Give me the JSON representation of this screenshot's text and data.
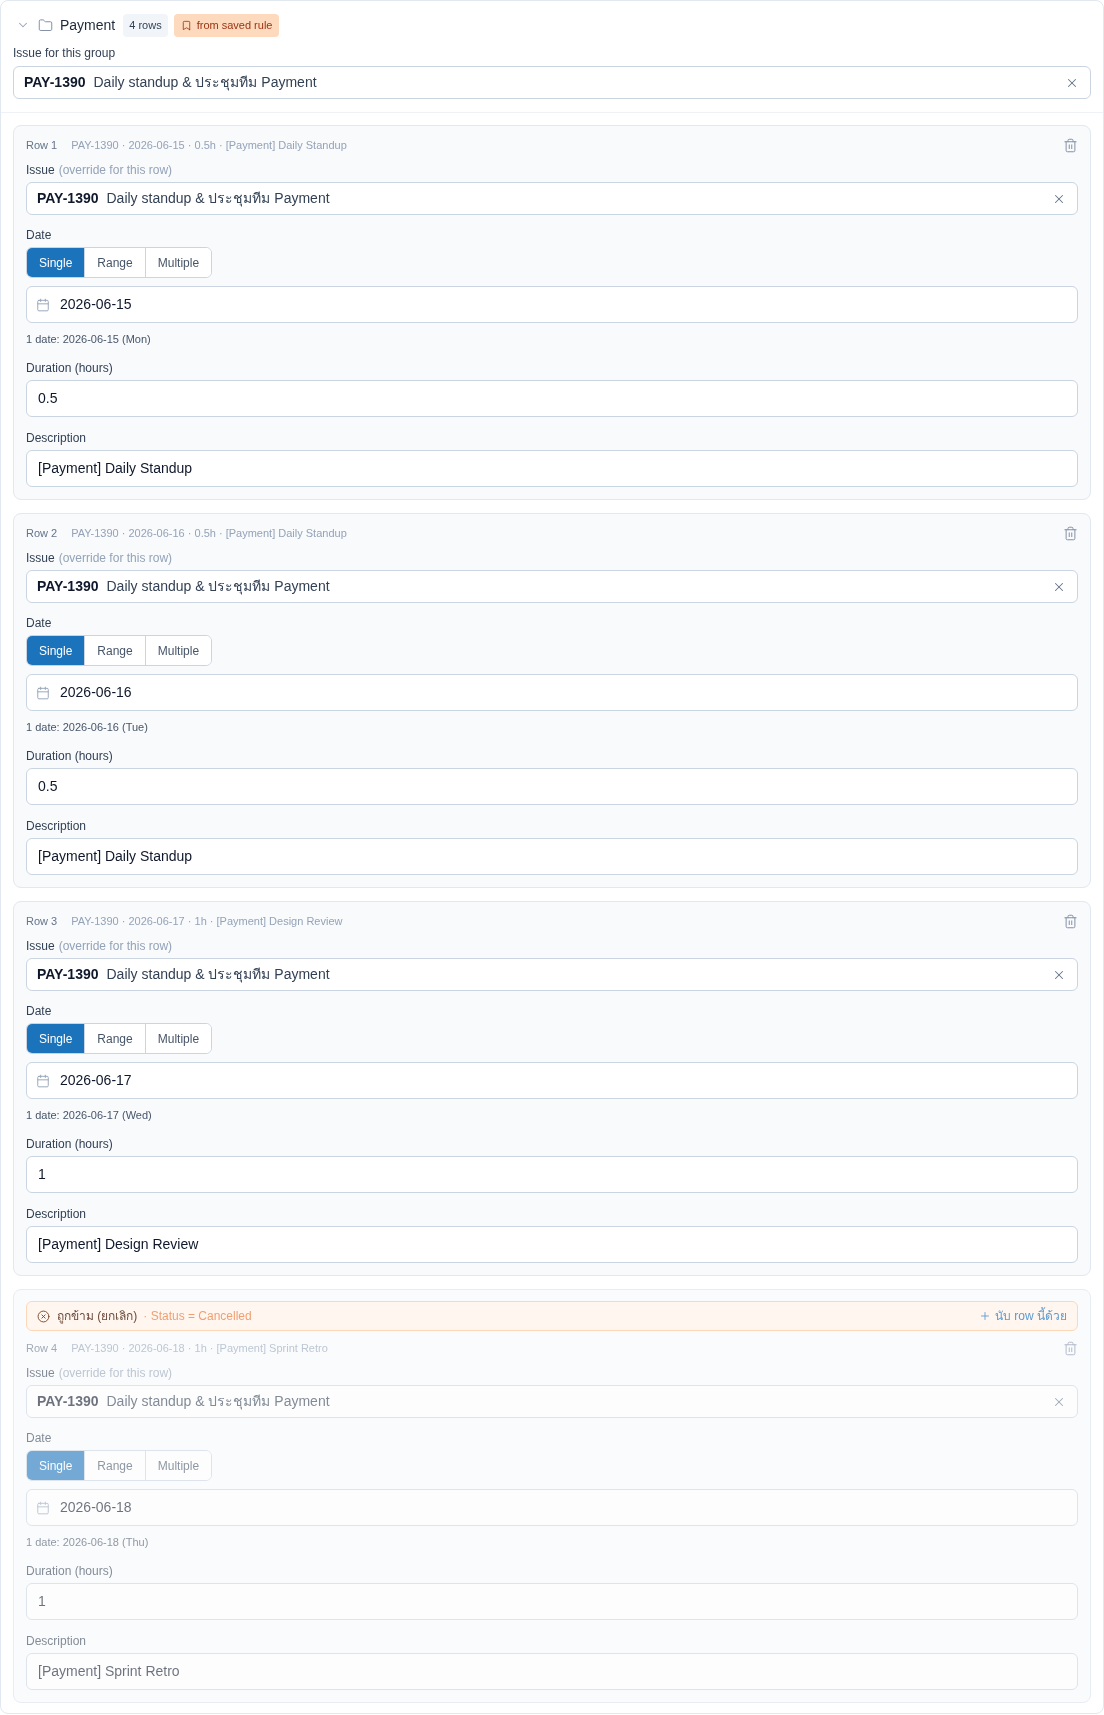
{
  "group": {
    "expanded": true,
    "name": "Payment",
    "row_count": "4 rows",
    "rule_tag": "from saved rule"
  },
  "group_issue": {
    "label": "Issue for this group",
    "key": "PAY-1390",
    "summary": "Daily standup & ประชุมทีม Payment"
  },
  "rows": [
    {
      "title": "Row 1",
      "summary": "PAY-1390 · 2026-06-15 · 0.5h · [Payment] Daily Standup",
      "skipped": false,
      "issue_label": "Issue",
      "issue_hint": "(override for this row)",
      "issue": {
        "key": "PAY-1390",
        "summary": "Daily standup & ประชุมทีม Payment"
      },
      "date_label": "Date",
      "date_modes": [
        {
          "label": "Single",
          "selected": true
        },
        {
          "label": "Range",
          "selected": false
        },
        {
          "label": "Multiple",
          "selected": false
        }
      ],
      "date": "2026-06-15",
      "date_note": "1 date: 2026-06-15 (Mon)",
      "duration_label": "Duration (hours)",
      "duration": "0.5",
      "description_label": "Description",
      "description": "[Payment] Daily Standup"
    },
    {
      "title": "Row 2",
      "summary": "PAY-1390 · 2026-06-16 · 0.5h · [Payment] Daily Standup",
      "skipped": false,
      "issue_label": "Issue",
      "issue_hint": "(override for this row)",
      "issue": {
        "key": "PAY-1390",
        "summary": "Daily standup & ประชุมทีม Payment"
      },
      "date_label": "Date",
      "date_modes": [
        {
          "label": "Single",
          "selected": true
        },
        {
          "label": "Range",
          "selected": false
        },
        {
          "label": "Multiple",
          "selected": false
        }
      ],
      "date": "2026-06-16",
      "date_note": "1 date: 2026-06-16 (Tue)",
      "duration_label": "Duration (hours)",
      "duration": "0.5",
      "description_label": "Description",
      "description": "[Payment] Daily Standup"
    },
    {
      "title": "Row 3",
      "summary": "PAY-1390 · 2026-06-17 · 1h · [Payment] Design Review",
      "skipped": false,
      "issue_label": "Issue",
      "issue_hint": "(override for this row)",
      "issue": {
        "key": "PAY-1390",
        "summary": "Daily standup & ประชุมทีม Payment"
      },
      "date_label": "Date",
      "date_modes": [
        {
          "label": "Single",
          "selected": true
        },
        {
          "label": "Range",
          "selected": false
        },
        {
          "label": "Multiple",
          "selected": false
        }
      ],
      "date": "2026-06-17",
      "date_note": "1 date: 2026-06-17 (Wed)",
      "duration_label": "Duration (hours)",
      "duration": "1",
      "description_label": "Description",
      "description": "[Payment] Design Review"
    },
    {
      "skip_notice": {
        "title": "ถูกข้าม (ยกเลิก)",
        "reason": "· Status = Cancelled",
        "action": "นับ row นี้ด้วย"
      },
      "title": "Row 4",
      "summary": "PAY-1390 · 2026-06-18 · 1h · [Payment] Sprint Retro",
      "skipped": true,
      "issue_label": "Issue",
      "issue_hint": "(override for this row)",
      "issue": {
        "key": "PAY-1390",
        "summary": "Daily standup & ประชุมทีม Payment"
      },
      "date_label": "Date",
      "date_modes": [
        {
          "label": "Single",
          "selected": true
        },
        {
          "label": "Range",
          "selected": false
        },
        {
          "label": "Multiple",
          "selected": false
        }
      ],
      "date": "2026-06-18",
      "date_note": "1 date: 2026-06-18 (Thu)",
      "duration_label": "Duration (hours)",
      "duration": "1",
      "description_label": "Description",
      "description": "[Payment] Sprint Retro"
    }
  ]
}
